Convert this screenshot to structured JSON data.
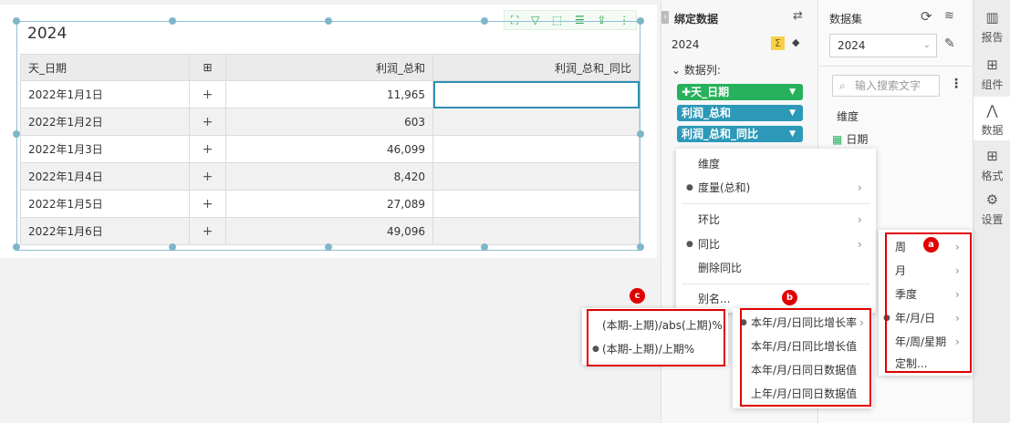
{
  "widget": {
    "title": "2024",
    "columns": [
      "天_日期",
      "利润_总和",
      "利润_总和_同比"
    ],
    "expand_symbol": "⊞",
    "rows": [
      {
        "date": "2022年1月1日",
        "profit": "11,965",
        "yoy": ""
      },
      {
        "date": "2022年1月2日",
        "profit": "603",
        "yoy": ""
      },
      {
        "date": "2022年1月3日",
        "profit": "46,099",
        "yoy": ""
      },
      {
        "date": "2022年1月4日",
        "profit": "8,420",
        "yoy": ""
      },
      {
        "date": "2022年1月5日",
        "profit": "27,089",
        "yoy": ""
      },
      {
        "date": "2022年1月6日",
        "profit": "49,096",
        "yoy": ""
      }
    ],
    "row_plus": "+",
    "toolbar_icons": [
      "expand-icon",
      "filter-icon",
      "select-icon",
      "list-icon",
      "export-icon",
      "more-icon"
    ]
  },
  "bind_panel": {
    "title": "绑定数据",
    "source": "2024",
    "sigma": "Σ",
    "columns_label": "数据列:",
    "chips": [
      {
        "label": "天_日期",
        "color": "#27b15c"
      },
      {
        "label": "利润_总和",
        "color": "#2c99b8"
      },
      {
        "label": "利润_总和_同比",
        "color": "#2c99b8"
      }
    ]
  },
  "dataset_panel": {
    "title": "数据集",
    "selected": "2024",
    "search_placeholder": "输入搜索文字",
    "dimension_label": "维度",
    "date_field": "日期"
  },
  "right_bar": {
    "tabs": [
      {
        "label": "报告",
        "icon": "report-icon"
      },
      {
        "label": "组件",
        "icon": "component-icon"
      },
      {
        "label": "数据",
        "icon": "data-icon",
        "active": true
      },
      {
        "label": "格式",
        "icon": "format-icon"
      },
      {
        "label": "设置",
        "icon": "settings-icon"
      }
    ]
  },
  "context_menu": {
    "items": [
      "维度",
      "度量(总和)",
      "环比",
      "同比",
      "删除同比",
      "别名..."
    ]
  },
  "submenu_a": {
    "marker": "a",
    "items": [
      "周",
      "月",
      "季度",
      "年/月/日",
      "年/周/星期",
      "定制..."
    ]
  },
  "submenu_b": {
    "marker": "b",
    "items": [
      "本年/月/日同比增长率",
      "本年/月/日同比增长值",
      "本年/月/日同日数据值",
      "上年/月/日同日数据值"
    ]
  },
  "submenu_c": {
    "marker": "c",
    "items": [
      "(本期-上期)/abs(上期)%",
      "(本期-上期)/上期%"
    ]
  },
  "colors": {
    "accent_green": "#27b15c",
    "accent_teal": "#2c99b8",
    "highlight_red": "#e00000"
  }
}
